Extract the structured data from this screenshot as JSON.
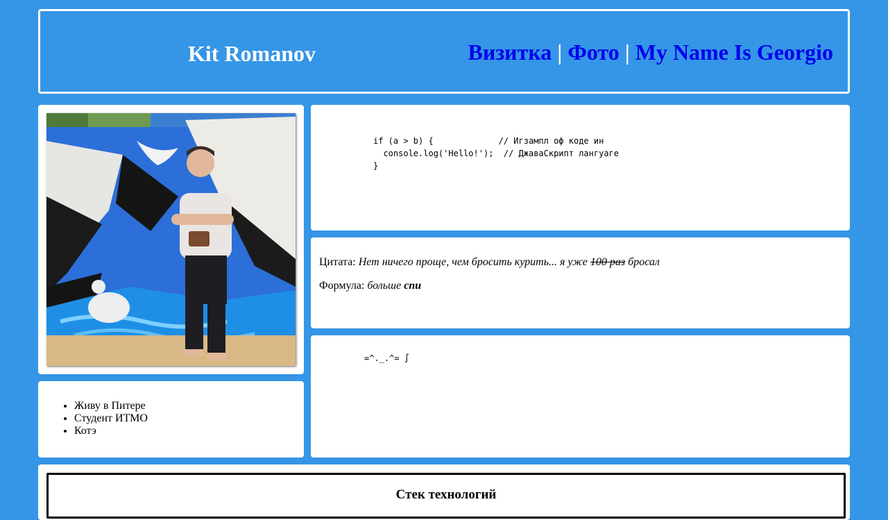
{
  "header": {
    "title": "Kit Romanov",
    "nav": [
      {
        "label": "Визитка"
      },
      {
        "label": "Фото"
      },
      {
        "label": "My Name Is Georgio"
      }
    ],
    "separator": "|"
  },
  "code": {
    "lines": [
      "if (a > b) {             // Игзампл оф коде ин",
      "  console.log('Hello!');  // ДжаваСкрипт лангуаге",
      "}"
    ]
  },
  "quote": {
    "label": "Цитата:",
    "before": "Нет ничего проще, чем бросить курить... я уже",
    "struck": "100 раз",
    "after": "бросал"
  },
  "formula": {
    "label": "Формула:",
    "italic": "больше",
    "bold_italic": "спи"
  },
  "ascii": "=^._.^= ∫",
  "about": {
    "items": [
      "Живу в Питере",
      "Студент ИТМО",
      "Котэ"
    ]
  },
  "stack": {
    "title": "Стек технологий"
  },
  "colors": {
    "background": "#3595e6",
    "link": "#0000ee",
    "card": "#ffffff"
  }
}
